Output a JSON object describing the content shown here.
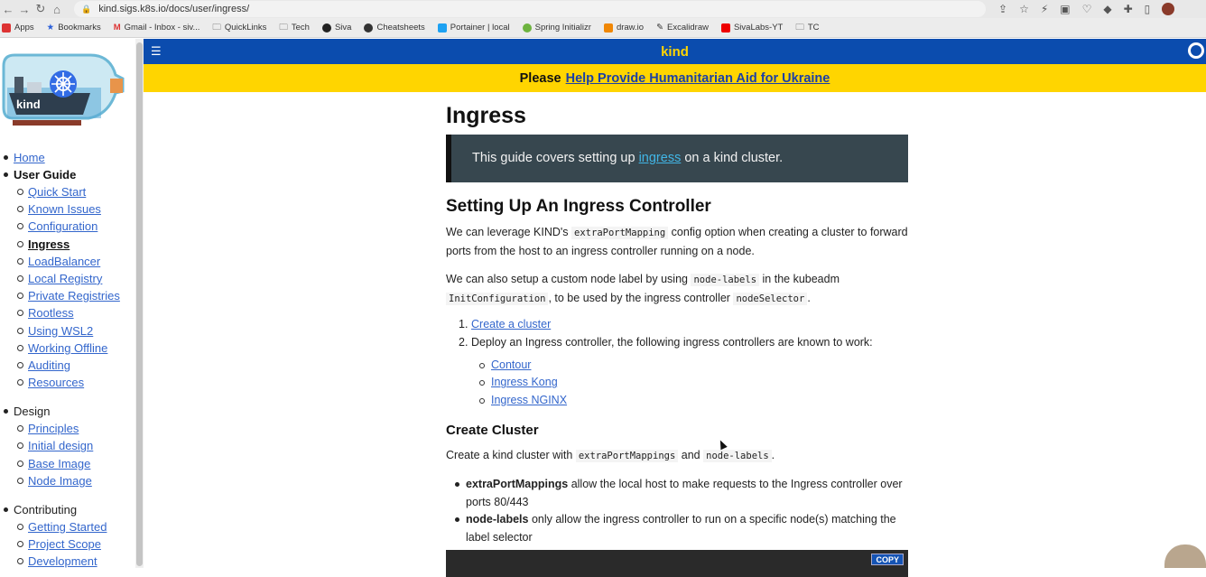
{
  "browser": {
    "url": "kind.sigs.k8s.io/docs/user/ingress/",
    "bookmarks": [
      "Apps",
      "Bookmarks",
      "Gmail - Inbox - siv...",
      "QuickLinks",
      "Tech",
      "Siva",
      "Cheatsheets",
      "Portainer | local",
      "Spring Initializr",
      "draw.io",
      "Excalidraw",
      "SivaLabs-YT",
      "TC"
    ]
  },
  "site": {
    "title": "kind",
    "banner_prefix": "Please",
    "banner_link": "Help Provide Humanitarian Aid for Ukraine",
    "logo_text": "kind"
  },
  "sidebar": {
    "home": "Home",
    "user_guide": "User Guide",
    "user_guide_items": [
      "Quick Start",
      "Known Issues",
      "Configuration",
      "Ingress",
      "LoadBalancer",
      "Local Registry",
      "Private Registries",
      "Rootless",
      "Using WSL2",
      "Working Offline",
      "Auditing",
      "Resources"
    ],
    "active_item": "Ingress",
    "design": "Design",
    "design_items": [
      "Principles",
      "Initial design",
      "Base Image",
      "Node Image"
    ],
    "contributing": "Contributing",
    "contributing_items": [
      "Getting Started",
      "Project Scope",
      "Development"
    ]
  },
  "article": {
    "h1": "Ingress",
    "callout_pre": "This guide covers setting up",
    "callout_link": "ingress",
    "callout_post": "on a kind cluster.",
    "h2": "Setting Up An Ingress Controller",
    "p1_a": "We can leverage KIND's",
    "p1_code": "extraPortMapping",
    "p1_b": "config option when creating a cluster to forward ports from the host to an ingress controller running on a node.",
    "p2_a": "We can also setup a custom node label by using",
    "p2_code1": "node-labels",
    "p2_b": "in the kubeadm",
    "p2_code2": "InitConfiguration",
    "p2_c": ", to be used by the ingress controller",
    "p2_code3": "nodeSelector",
    "p2_d": ".",
    "steps": [
      "Create a cluster",
      "Deploy an Ingress controller, the following ingress controllers are known to work:"
    ],
    "controllers": [
      "Contour",
      "Ingress Kong",
      "Ingress NGINX"
    ],
    "h3": "Create Cluster",
    "p3_a": "Create a kind cluster with",
    "p3_code1": "extraPortMappings",
    "p3_b": "and",
    "p3_code2": "node-labels",
    "p3_c": ".",
    "bullets": [
      {
        "term": "extraPortMappings",
        "text": "allow the local host to make requests to the Ingress controller over ports 80/443"
      },
      {
        "term": "node-labels",
        "text": "only allow the ingress controller to run on a specific node(s) matching the label selector"
      }
    ],
    "copy_label": "COPY"
  }
}
